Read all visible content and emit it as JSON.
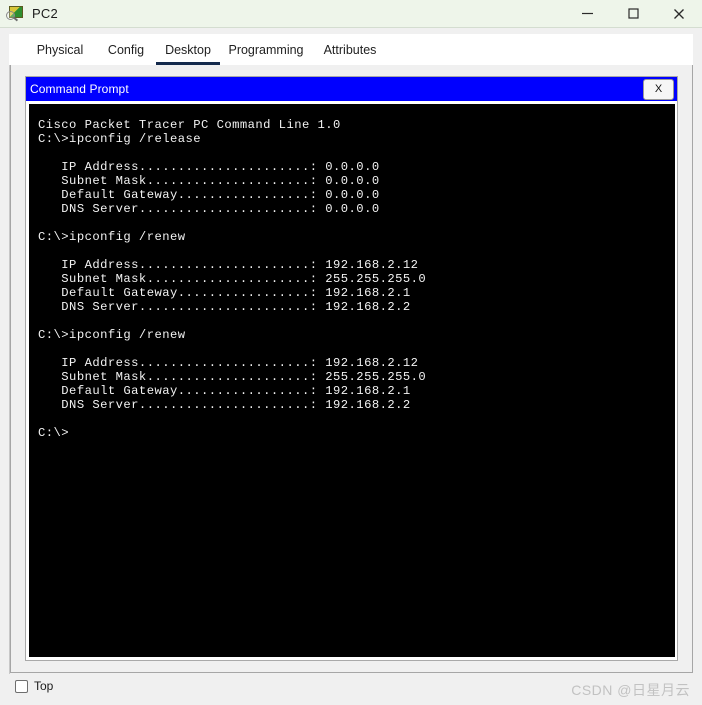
{
  "window": {
    "title": "PC2",
    "icon": "packet-tracer-device-icon",
    "controls": {
      "minimize_label": "—",
      "maximize_label": "□",
      "close_label": "✕"
    }
  },
  "tabs": [
    {
      "label": "Physical",
      "active": false
    },
    {
      "label": "Config",
      "active": false
    },
    {
      "label": "Desktop",
      "active": true
    },
    {
      "label": "Programming",
      "active": false
    },
    {
      "label": "Attributes",
      "active": false
    }
  ],
  "command_prompt": {
    "title": "Command Prompt",
    "close_label": "X",
    "terminal": {
      "banner": "Cisco Packet Tracer PC Command Line 1.0",
      "lines": [
        "Cisco Packet Tracer PC Command Line 1.0",
        "C:\\>ipconfig /release",
        "",
        "   IP Address......................: 0.0.0.0",
        "   Subnet Mask.....................: 0.0.0.0",
        "   Default Gateway.................: 0.0.0.0",
        "   DNS Server......................: 0.0.0.0",
        "",
        "C:\\>ipconfig /renew",
        "",
        "   IP Address......................: 192.168.2.12",
        "   Subnet Mask.....................: 255.255.255.0",
        "   Default Gateway.................: 192.168.2.1",
        "   DNS Server......................: 192.168.2.2",
        "",
        "C:\\>ipconfig /renew",
        "",
        "   IP Address......................: 192.168.2.12",
        "   Subnet Mask.....................: 255.255.255.0",
        "   Default Gateway.................: 192.168.2.1",
        "   DNS Server......................: 192.168.2.2",
        "",
        "C:\\>"
      ],
      "commands": [
        "ipconfig /release",
        "ipconfig /renew",
        "ipconfig /renew"
      ],
      "results": [
        {
          "command": "ipconfig /release",
          "ip_address": "0.0.0.0",
          "subnet_mask": "0.0.0.0",
          "default_gateway": "0.0.0.0",
          "dns_server": "0.0.0.0"
        },
        {
          "command": "ipconfig /renew",
          "ip_address": "192.168.2.12",
          "subnet_mask": "255.255.255.0",
          "default_gateway": "192.168.2.1",
          "dns_server": "192.168.2.2"
        },
        {
          "command": "ipconfig /renew",
          "ip_address": "192.168.2.12",
          "subnet_mask": "255.255.255.0",
          "default_gateway": "192.168.2.1",
          "dns_server": "192.168.2.2"
        }
      ]
    }
  },
  "bottom": {
    "top_checkbox_label": "Top",
    "top_checkbox_checked": false,
    "watermark": "CSDN @日星月云"
  },
  "colors": {
    "titlebar_bg": "#eef5ea",
    "cmd_titlebar_bg": "#0000ff",
    "terminal_bg": "#000000",
    "terminal_fg": "#f2f2f2",
    "active_tab_underline": "#13294b",
    "panel_bg": "#f0f0f0"
  }
}
